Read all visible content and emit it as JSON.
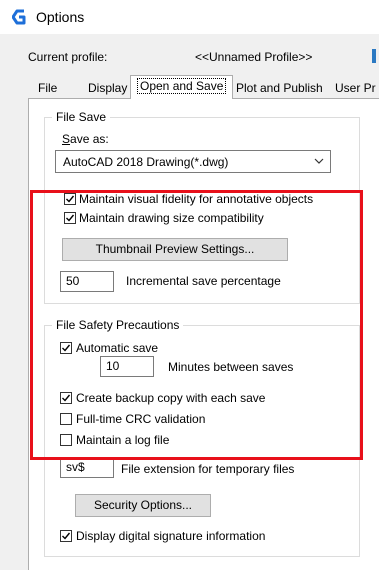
{
  "window": {
    "title": "Options",
    "icon": "autocad-logo-icon"
  },
  "profile": {
    "label": "Current profile:",
    "value": "<<Unnamed Profile>>"
  },
  "tabs": [
    {
      "label": "File",
      "active": false
    },
    {
      "label": "Display",
      "active": false
    },
    {
      "label": "Open and Save",
      "active": true
    },
    {
      "label": "Plot and Publish",
      "active": false
    },
    {
      "label": "User Pr",
      "active": false
    }
  ],
  "file_save": {
    "group_title": "File Save",
    "save_as_label": "Save as:",
    "save_as_value": "AutoCAD 2018 Drawing(*.dwg)",
    "maintain_fidelity": {
      "label": "Maintain visual fidelity for annotative objects",
      "checked": true
    },
    "maintain_size": {
      "label": "Maintain drawing size compatibility",
      "checked": true
    },
    "thumbnail_button": "Thumbnail Preview Settings...",
    "incremental_value": "50",
    "incremental_label": "Incremental save percentage"
  },
  "file_safety": {
    "group_title": "File Safety Precautions",
    "automatic_save": {
      "label": "Automatic save",
      "checked": true
    },
    "minutes_value": "10",
    "minutes_label": "Minutes between saves",
    "backup_copy": {
      "label": "Create backup copy with each save",
      "checked": true
    },
    "crc_validation": {
      "label": "Full-time CRC validation",
      "checked": false
    },
    "log_file": {
      "label": "Maintain a log file",
      "checked": false
    },
    "extension_value": "sv$",
    "extension_label": "File extension for temporary files",
    "security_button": "Security Options...",
    "digital_signature": {
      "label": "Display digital signature information",
      "checked": true
    }
  },
  "colors": {
    "accent_highlight": "#e8101a",
    "autocad_blue": "#1e6fd9"
  }
}
